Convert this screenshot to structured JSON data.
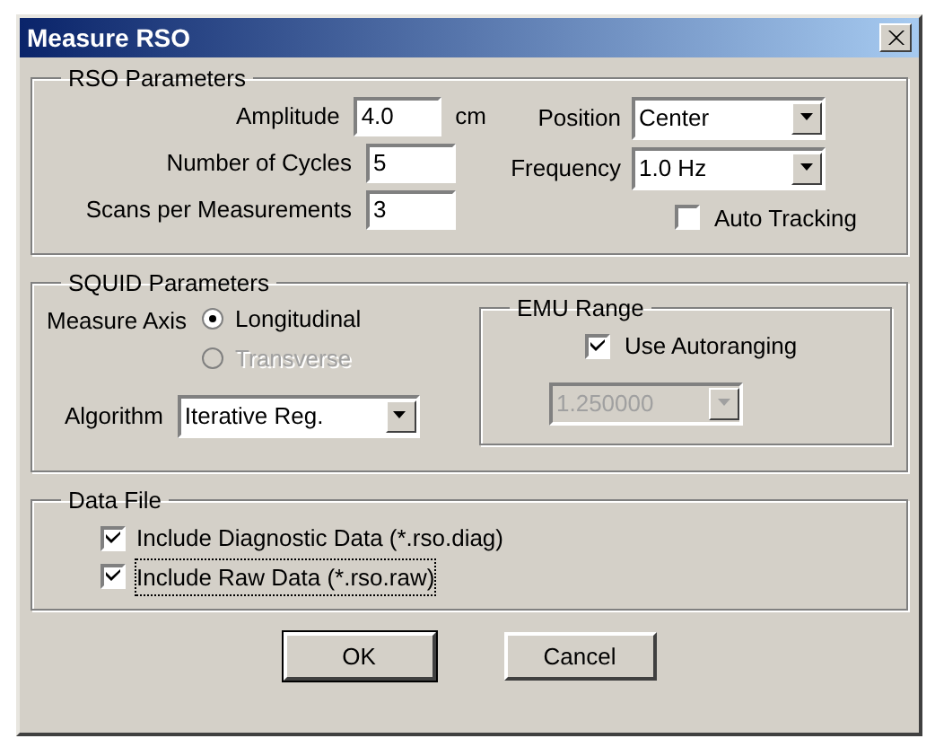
{
  "window": {
    "title": "Measure RSO"
  },
  "rso_parameters": {
    "title": "RSO  Parameters",
    "amplitude": {
      "label": "Amplitude",
      "value": "4.0",
      "unit": "cm"
    },
    "cycles": {
      "label": "Number of Cycles",
      "value": "5"
    },
    "scans": {
      "label": "Scans per Measurements",
      "value": "3"
    },
    "position": {
      "label": "Position",
      "value": "Center"
    },
    "frequency": {
      "label": "Frequency",
      "value": "1.0 Hz"
    },
    "auto_tracking": {
      "label": "Auto Tracking",
      "checked": false
    }
  },
  "squid_parameters": {
    "title": "SQUID Parameters",
    "measure_axis": {
      "label": "Measure Axis",
      "options": [
        {
          "label": "Longitudinal",
          "selected": true,
          "disabled": false
        },
        {
          "label": "Transverse",
          "selected": false,
          "disabled": true
        }
      ]
    },
    "algorithm": {
      "label": "Algorithm",
      "value": "Iterative Reg."
    },
    "emu_range": {
      "title": "EMU Range",
      "autoranging": {
        "label": "Use Autoranging",
        "checked": true
      },
      "range": {
        "value": "1.250000",
        "disabled": true
      }
    }
  },
  "data_file": {
    "title": "Data File",
    "options": [
      {
        "label": "Include Diagnostic Data (*.rso.diag)",
        "checked": true,
        "focused": false
      },
      {
        "label": "Include Raw Data (*.rso.raw)",
        "checked": true,
        "focused": true
      }
    ]
  },
  "buttons": [
    {
      "label": "OK",
      "default": true
    },
    {
      "label": "Cancel",
      "default": false
    }
  ]
}
